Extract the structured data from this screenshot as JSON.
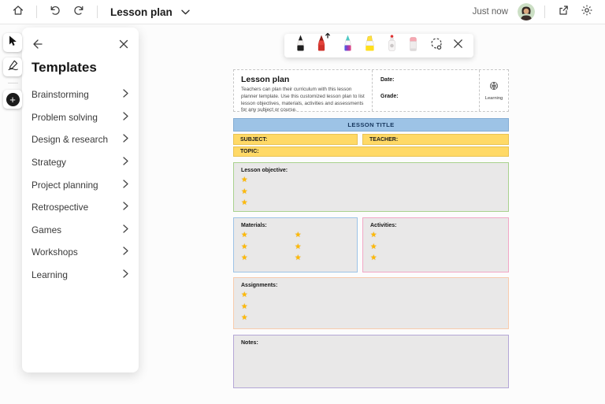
{
  "topbar": {
    "title": "Lesson plan",
    "status": "Just now"
  },
  "templates_panel": {
    "title": "Templates",
    "items": [
      {
        "label": "Brainstorming"
      },
      {
        "label": "Problem solving"
      },
      {
        "label": "Design & research"
      },
      {
        "label": "Strategy"
      },
      {
        "label": "Project planning"
      },
      {
        "label": "Retrospective"
      },
      {
        "label": "Games"
      },
      {
        "label": "Workshops"
      },
      {
        "label": "Learning"
      }
    ]
  },
  "pen_toolbar": {
    "tools": [
      "black-pen",
      "red-pen-active",
      "galaxy-pen",
      "yellow-highlighter",
      "spray-marker",
      "eraser",
      "lasso-select",
      "close"
    ]
  },
  "lesson": {
    "star_glyph": "★",
    "header": {
      "title": "Lesson plan",
      "description": "Teachers can plan their curriculum with this lesson planner template. Use this customized lesson plan to list lesson objectives, materials, activities and assessments for any subject or course.",
      "date_label": "Date:",
      "grade_label": "Grade:",
      "category_label": "Learning"
    },
    "title_bar_label": "LESSON TITLE",
    "subject_label": "SUBJECT:",
    "teacher_label": "TEACHER:",
    "topic_label": "TOPIC:",
    "sections": {
      "objective": {
        "label": "Lesson objective:",
        "stars": 3
      },
      "materials": {
        "label": "Materials:",
        "stars_col1": 3,
        "stars_col2": 3
      },
      "activities": {
        "label": "Activities:",
        "stars": 3
      },
      "assignments": {
        "label": "Assignments:",
        "stars": 3
      },
      "notes": {
        "label": "Notes:"
      }
    }
  },
  "colors": {
    "title-bar-bg": "#9DC3E6",
    "title-bar-text": "#17375E",
    "field-yellow": "#FFD966",
    "box-bg": "#E9E8E8",
    "objective-border": "#A9D18E",
    "materials-border": "#9DC3E6",
    "activities-border": "#F2A7C6",
    "assignments-border": "#F8CBAD",
    "notes-border": "#B4A7D6",
    "star-gold": "#FFB900"
  }
}
